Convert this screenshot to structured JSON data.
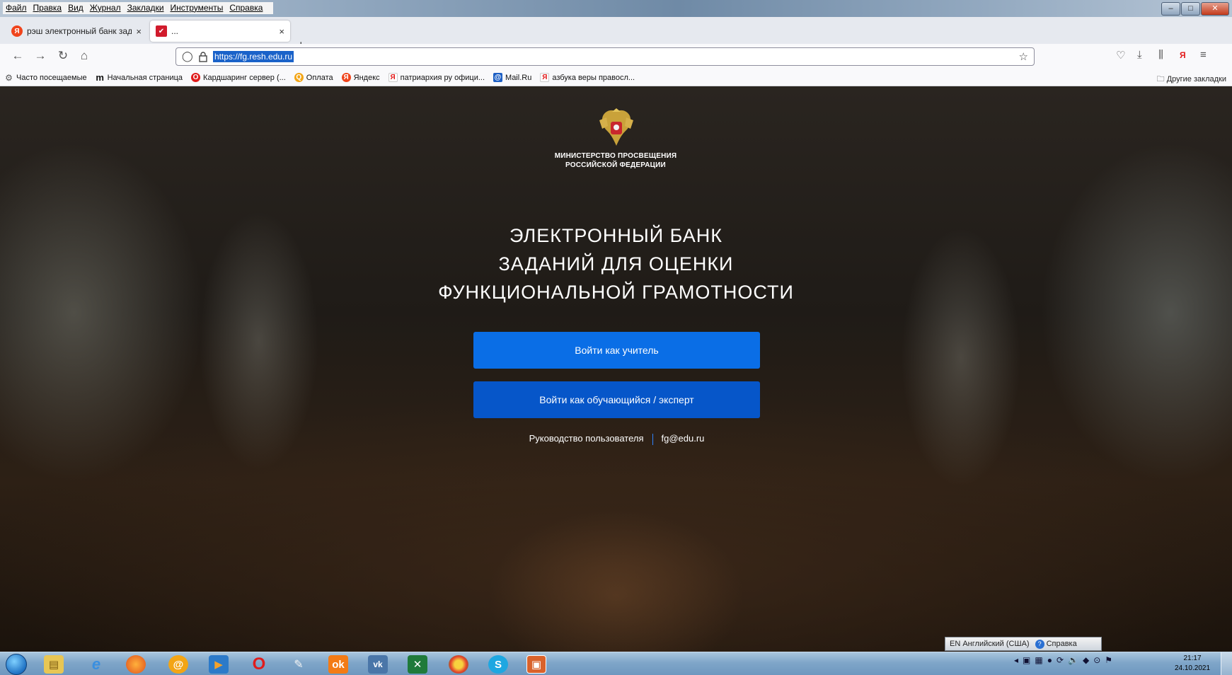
{
  "menubar": {
    "items": [
      "Файл",
      "Правка",
      "Вид",
      "Журнал",
      "Закладки",
      "Инструменты",
      "Справка"
    ]
  },
  "tabs": [
    {
      "title": "рэш электронный банк задани",
      "close": "×"
    },
    {
      "title": "...",
      "close": "×"
    }
  ],
  "new_tab": "+",
  "url": "https://fg.resh.edu.ru",
  "bookmarks": [
    {
      "label": "Часто посещаемые",
      "icon": "gear-icon"
    },
    {
      "label": "Начальная страница",
      "icon": "m-logo-icon"
    },
    {
      "label": "Кардшаринг сервер (...",
      "icon": "opera-icon"
    },
    {
      "label": "Оплата",
      "icon": "q-icon"
    },
    {
      "label": "Яндекс",
      "icon": "yandex-icon"
    },
    {
      "label": "патриархия ру офици...",
      "icon": "yandex-icon"
    },
    {
      "label": "Mail.Ru",
      "icon": "mailru-icon"
    },
    {
      "label": "азбука веры правосл...",
      "icon": "yandex-icon"
    }
  ],
  "other_bookmarks": "Другие закладки",
  "page": {
    "ministry_line1": "МИНИСТЕРСТВО ПРОСВЕЩЕНИЯ",
    "ministry_line2": "РОССИЙСКОЙ ФЕДЕРАЦИИ",
    "title_line1": "ЭЛЕКТРОННЫЙ БАНК",
    "title_line2": "ЗАДАНИЙ ДЛЯ ОЦЕНКИ",
    "title_line3": "ФУНКЦИОНАЛЬНОЙ ГРАМОТНОСТИ",
    "btn_teacher": "Войти как учитель",
    "btn_student": "Войти как обучающийся / эксперт",
    "link_guide": "Руководство пользователя",
    "link_email": "fg@edu.ru"
  },
  "language_bar": {
    "lang": "EN Английский (США)",
    "help": "Справка"
  },
  "clock": {
    "time": "21:17",
    "date": "24.10.2021"
  },
  "colors": {
    "btn_teacher": "#0a6ee6",
    "btn_student": "#0656c9",
    "url_highlight": "#1a62c9"
  }
}
